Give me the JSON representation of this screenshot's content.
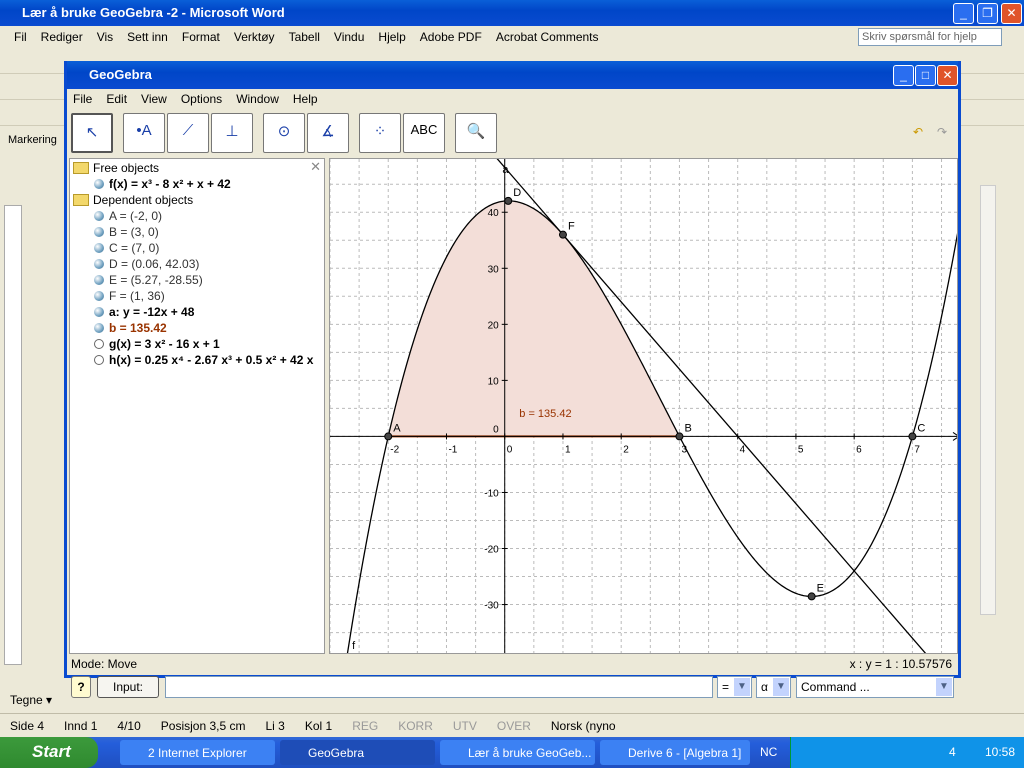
{
  "word": {
    "title": "Lær å bruke GeoGebra -2 - Microsoft Word",
    "menu": [
      "Fil",
      "Rediger",
      "Vis",
      "Sett inn",
      "Format",
      "Verktøy",
      "Tabell",
      "Vindu",
      "Hjelp",
      "Adobe PDF",
      "Acrobat Comments"
    ],
    "help_placeholder": "Skriv spørsmål for hjelp",
    "style_box": "Markering",
    "draw_label": "Tegne ▾",
    "status": [
      "Side 4",
      "Innd 1",
      "4/10",
      "Posisjon 3,5 cm",
      "Li 3",
      "Kol 1",
      "REG",
      "KORR",
      "UTV",
      "OVER",
      "Norsk (nyno"
    ]
  },
  "taskbar": {
    "start": "Start",
    "tasks": [
      {
        "label": "2 Internet Explorer"
      },
      {
        "label": "GeoGebra"
      },
      {
        "label": "Lær å bruke GeoGeb..."
      },
      {
        "label": "Derive 6 - [Algebra 1]"
      }
    ],
    "nc": "NC",
    "tray_num": "4",
    "clock": "10:58"
  },
  "geogebra": {
    "title": "GeoGebra",
    "menu": [
      "File",
      "Edit",
      "View",
      "Options",
      "Window",
      "Help"
    ],
    "tools": [
      "move",
      "point",
      "line",
      "perpendicular",
      "circle",
      "angle",
      "reflect",
      "text",
      "zoom"
    ],
    "text_tool_label": "ABC",
    "algebra": {
      "free_header": "Free objects",
      "free": [
        {
          "text": "f(x) = x³ - 8 x² + x + 42",
          "bold": true
        }
      ],
      "dependent_header": "Dependent objects",
      "dependent": [
        {
          "text": "A = (-2, 0)"
        },
        {
          "text": "B = (3, 0)"
        },
        {
          "text": "C = (7, 0)"
        },
        {
          "text": "D = (0.06, 42.03)"
        },
        {
          "text": "E = (5.27, -28.55)"
        },
        {
          "text": "F = (1, 36)"
        },
        {
          "text": "a: y = -12x + 48",
          "bold": true
        },
        {
          "text": "b = 135.42",
          "bold": true,
          "color": "#993300"
        },
        {
          "text": "g(x) = 3 x² - 16 x + 1",
          "bold": true,
          "hidden": true
        },
        {
          "text": "h(x) = 0.25 x⁴ - 2.67 x³ + 0.5 x² + 42 x",
          "bold": true,
          "hidden": true
        }
      ]
    },
    "graph": {
      "xlim": [
        -3.0,
        7.8
      ],
      "ylim": [
        -39,
        49.5
      ],
      "x_ticks": [
        -2,
        -1,
        0,
        1,
        2,
        3,
        4,
        5,
        6,
        7
      ],
      "y_ticks": [
        -30,
        -20,
        -10,
        0,
        10,
        20,
        30,
        40
      ],
      "grid": true,
      "function_f": "x^3-8x^2+x+42",
      "label_f": "f",
      "line_a": "-12x+48",
      "label_a": "a",
      "integral_label": "b = 135.42",
      "integral_range": [
        -2,
        3
      ],
      "fill_color": "#f3ded8",
      "integral_color": "#993300",
      "points": [
        {
          "name": "A",
          "x": -2,
          "y": 0
        },
        {
          "name": "B",
          "x": 3,
          "y": 0
        },
        {
          "name": "C",
          "x": 7,
          "y": 0
        },
        {
          "name": "D",
          "x": 0.06,
          "y": 42.03
        },
        {
          "name": "E",
          "x": 5.27,
          "y": -28.55
        },
        {
          "name": "F",
          "x": 1,
          "y": 36
        }
      ]
    },
    "mode": "Mode: Move",
    "ratio": "x : y = 1 : 10.57576",
    "input_label": "Input:",
    "input_value": "",
    "combo_eq": "=",
    "combo_alpha": "α",
    "combo_command": "Command ..."
  }
}
